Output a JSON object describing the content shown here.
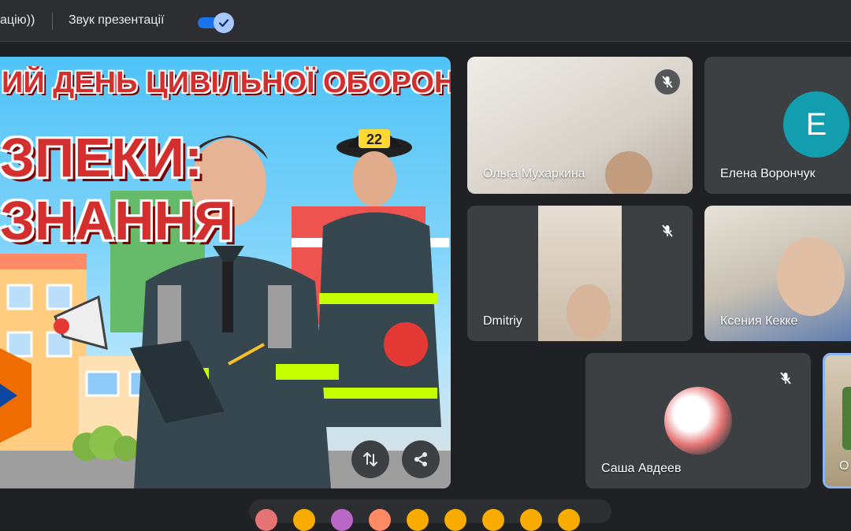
{
  "topbar": {
    "truncated_label": "ацію))",
    "sound_label": "Звук презентації",
    "sound_toggle_on": true
  },
  "presentation": {
    "banner_text": "ИЙ ДЕНЬ ЦИВІЛЬНОЇ ОБОРОНИ",
    "headline_line1": "ЗПЕКИ:",
    "headline_line2": "ЗНАННЯ",
    "helmet_number": "22"
  },
  "participants": [
    {
      "name": "Ольга Мухаркина",
      "muted": true
    },
    {
      "name": "Елена Ворончук",
      "avatar_letter": "E"
    },
    {
      "name": "Dmitriy",
      "muted": true
    },
    {
      "name": "Ксения Кекке"
    },
    {
      "name": "Саша Авдеев",
      "muted": true
    },
    {
      "name": "О"
    }
  ],
  "colors": {
    "accent": "#1a73e8",
    "avatar_bg": "#129eaf",
    "tile_bg": "#3c4043",
    "page_bg": "#202124"
  }
}
